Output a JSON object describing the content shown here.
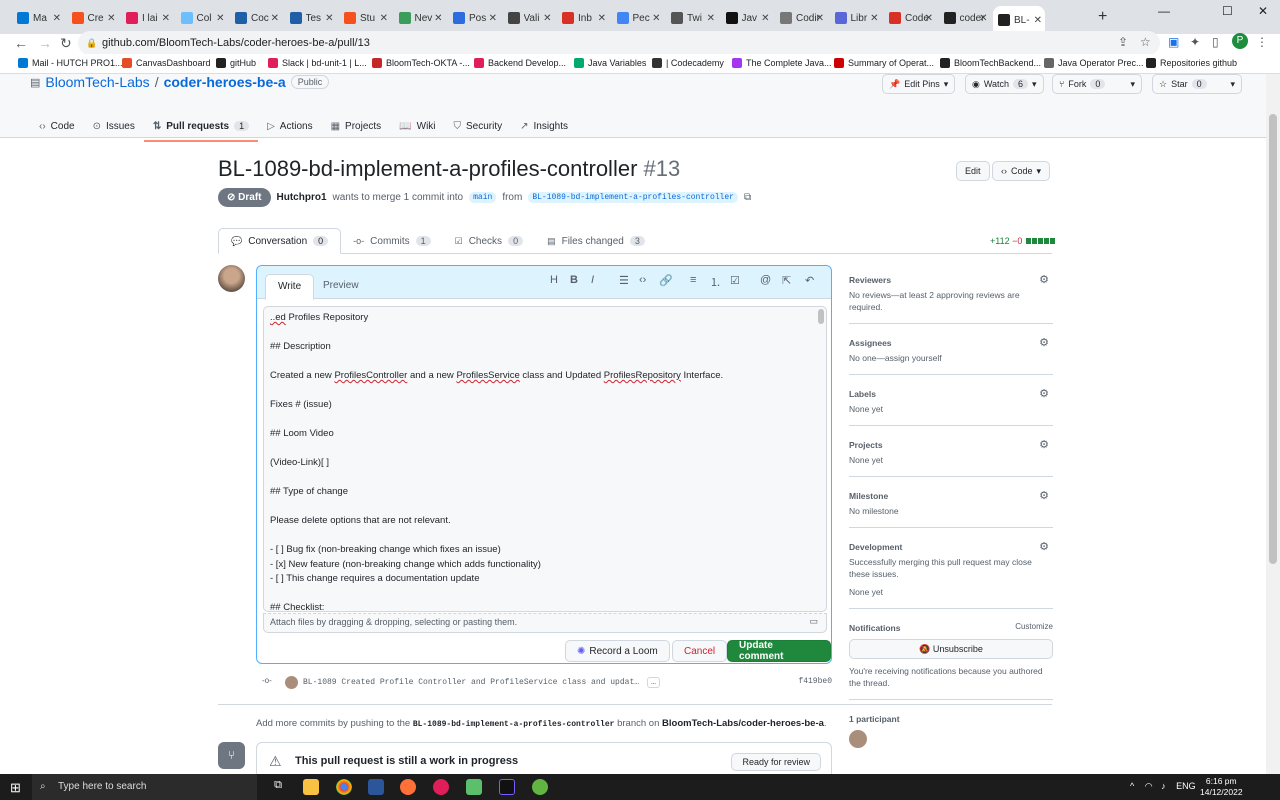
{
  "browser": {
    "tabs": [
      {
        "label": "Ma",
        "color": "#0078d4"
      },
      {
        "label": "Cre",
        "color": "#f4511e"
      },
      {
        "label": "I lai",
        "color": "#e01e5a"
      },
      {
        "label": "Col",
        "color": "#6dbeff"
      },
      {
        "label": "Coc",
        "color": "#1f5fa8"
      },
      {
        "label": "Tes",
        "color": "#1f5fa8"
      },
      {
        "label": "Stu",
        "color": "#f4511e"
      },
      {
        "label": "Nev",
        "color": "#3a9e5a"
      },
      {
        "label": "Pos",
        "color": "#2d6cdf"
      },
      {
        "label": "Vali",
        "color": "#444444"
      },
      {
        "label": "Inb",
        "color": "#d93025"
      },
      {
        "label": "Pec",
        "color": "#4285f4"
      },
      {
        "label": "Twi",
        "color": "#555555"
      },
      {
        "label": "Jav",
        "color": "#111111"
      },
      {
        "label": "Coding",
        "color": "#777777"
      },
      {
        "label": "Libr",
        "color": "#5a67d8"
      },
      {
        "label": "CoderH",
        "color": "#d93025"
      },
      {
        "label": "coder-h",
        "color": "#222222"
      },
      {
        "label": "BL-",
        "color": "#222222"
      }
    ],
    "url": "github.com/BloomTech-Labs/coder-heroes-be-a/pull/13",
    "profile_initial": "P",
    "bookmarks": [
      {
        "label": "Mail - HUTCH PRO1...",
        "color": "#0078d4"
      },
      {
        "label": "CanvasDashboard",
        "color": "#e44d26"
      },
      {
        "label": "gitHub",
        "color": "#222222"
      },
      {
        "label": "Slack | bd-unit-1 | L...",
        "color": "#e01e5a"
      },
      {
        "label": "BloomTech-OKTA -...",
        "color": "#c62828"
      },
      {
        "label": "Backend Develop...",
        "color": "#e01e5a"
      },
      {
        "label": "Java Variables",
        "color": "#04aa6d"
      },
      {
        "label": "| Codecademy",
        "color": "#333333"
      },
      {
        "label": "The Complete Java...",
        "color": "#a435f0"
      },
      {
        "label": "Summary of Operat...",
        "color": "#cc0000"
      },
      {
        "label": "BloomTechBackend...",
        "color": "#222222"
      },
      {
        "label": "Java Operator Prec...",
        "color": "#666666"
      },
      {
        "label": "Repositories github",
        "color": "#222222"
      }
    ]
  },
  "repo": {
    "owner": "BloomTech-Labs",
    "separator": "/",
    "name": "coder-heroes-be-a",
    "visibility": "Public",
    "edit_pins": "Edit Pins",
    "watch": "Watch",
    "watch_count": "6",
    "fork": "Fork",
    "fork_count": "0",
    "star": "Star",
    "star_count": "0",
    "nav": [
      {
        "label": "Code",
        "icon": "code-icon",
        "count": ""
      },
      {
        "label": "Issues",
        "icon": "issue-icon",
        "count": ""
      },
      {
        "label": "Pull requests",
        "icon": "pull-request-icon",
        "count": "1"
      },
      {
        "label": "Actions",
        "icon": "play-icon",
        "count": ""
      },
      {
        "label": "Projects",
        "icon": "table-icon",
        "count": ""
      },
      {
        "label": "Wiki",
        "icon": "book-icon",
        "count": ""
      },
      {
        "label": "Security",
        "icon": "shield-icon",
        "count": ""
      },
      {
        "label": "Insights",
        "icon": "graph-icon",
        "count": ""
      }
    ]
  },
  "pr": {
    "title": "BL-1089-bd-implement-a-profiles-controller",
    "number": "#13",
    "edit_label": "Edit",
    "code_label": "Code",
    "draft_label": "Draft",
    "author": "Hutchpro1",
    "merge_text": "wants to merge 1 commit into",
    "base_branch": "main",
    "from_text": "from",
    "head_branch": "BL-1089-bd-implement-a-profiles-controller",
    "tabs": [
      {
        "label": "Conversation",
        "count": "0"
      },
      {
        "label": "Commits",
        "count": "1"
      },
      {
        "label": "Checks",
        "count": "0"
      },
      {
        "label": "Files changed",
        "count": "3"
      }
    ],
    "additions": "+112",
    "deletions": "−0"
  },
  "editor": {
    "write_tab": "Write",
    "preview_tab": "Preview",
    "lines": [
      "...ed Profiles Repository",
      "",
      "## Description",
      "",
      "Created a new ProfilesController and a new ProfilesService class and Updated ProfilesRepository Interface.",
      "",
      "Fixes # (issue)",
      "",
      "## Loom Video",
      "",
      "(Video-Link)[ ]",
      "",
      "## Type of change",
      "",
      "Please delete options that are not relevant.",
      "",
      "- [ ] Bug fix (non-breaking change which fixes an issue)",
      "- [x] New feature (non-breaking change which adds functionality)",
      "- [ ] This change requires a documentation update",
      "",
      "## Checklist:"
    ],
    "attach_hint": "Attach files by dragging & dropping, selecting or pasting them.",
    "record_loom": "Record a Loom",
    "cancel": "Cancel",
    "update": "Update comment"
  },
  "commit": {
    "message": "BL-1089 Created Profile Controller and ProfileService class and updat…",
    "ellipsis": "…",
    "sha": "f419be0"
  },
  "add_commits": {
    "prefix": "Add more commits by pushing to the",
    "branch": "BL-1089-bd-implement-a-profiles-controller",
    "middle": "branch on",
    "repo": "BloomTech-Labs/coder-heroes-be-a",
    "suffix": "."
  },
  "merge": {
    "title": "This pull request is still a work in progress",
    "ready_button": "Ready for review"
  },
  "sidebar": {
    "reviewers": {
      "heading": "Reviewers",
      "value": "No reviews—at least 2 approving reviews are required."
    },
    "assignees": {
      "heading": "Assignees",
      "value": "No one—assign yourself"
    },
    "labels": {
      "heading": "Labels",
      "value": "None yet"
    },
    "projects": {
      "heading": "Projects",
      "value": "None yet"
    },
    "milestone": {
      "heading": "Milestone",
      "value": "No milestone"
    },
    "development": {
      "heading": "Development",
      "value": "Successfully merging this pull request may close these issues.",
      "value2": "None yet"
    },
    "notifications": {
      "heading": "Notifications",
      "customize": "Customize",
      "button": "Unsubscribe",
      "note": "You're receiving notifications because you authored the thread."
    },
    "participants": {
      "heading": "1 participant"
    }
  },
  "taskbar": {
    "search_placeholder": "Type here to search",
    "language": "ENG",
    "time": "6:16 pm",
    "date": "14/12/2022"
  }
}
